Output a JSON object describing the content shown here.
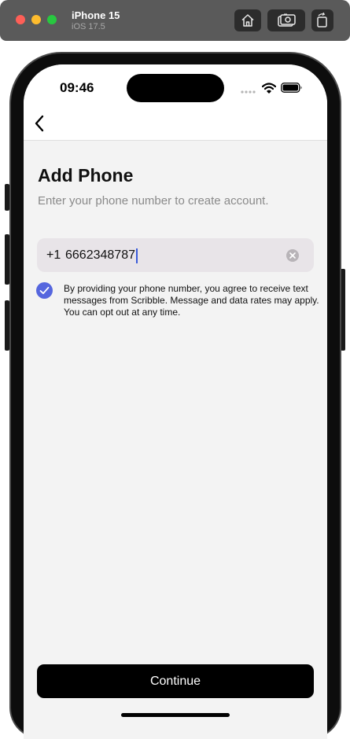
{
  "simulator": {
    "device_name": "iPhone 15",
    "os_version": "iOS 17.5",
    "toolbar_icons": [
      "home-icon",
      "screenshot-icon",
      "rotate-icon"
    ]
  },
  "status_bar": {
    "time": "09:46",
    "icons": [
      "cellular-signal-icon",
      "wifi-icon",
      "battery-icon"
    ]
  },
  "nav": {
    "back_icon": "chevron-left-icon"
  },
  "screen": {
    "title": "Add Phone",
    "subtitle": "Enter your phone number to create account.",
    "phone": {
      "country_code": "+1",
      "value": "6662348787",
      "clear_icon": "clear-x-icon"
    },
    "consent": {
      "checked": true,
      "text": "By providing your phone number, you agree to receive text messages from Scribble. Message and data rates may apply. You can opt out at any time."
    },
    "continue_label": "Continue"
  },
  "colors": {
    "accent": "#5566de",
    "primary_button": "#000000",
    "background": "#f3f3f3",
    "input_background": "#e8e4e8",
    "subtitle_text": "#8a8a8a"
  }
}
